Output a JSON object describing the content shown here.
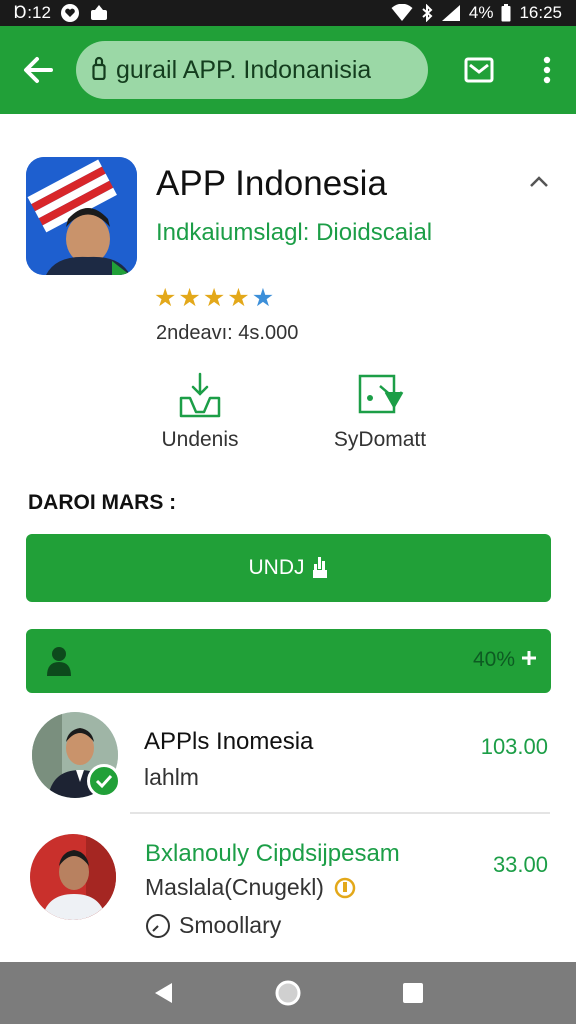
{
  "status_bar": {
    "time_left": "Ɒ:12",
    "battery": "4%",
    "time_right": "16:25"
  },
  "app_bar": {
    "url": "gurail APP. Indonanisia",
    "icons": [
      "back-arrow-icon",
      "lock-icon",
      "mail-icon",
      "more-vert-icon"
    ]
  },
  "app": {
    "title": "APP Indonesia",
    "developer": "Indkaiumslagl: Dioidscaial",
    "rating_stars": 5,
    "downloads": "2ndeavı: 4s.000"
  },
  "actions": [
    {
      "label": "Undenis",
      "icon": "download-hand-icon"
    },
    {
      "label": "SyDomatt",
      "icon": "share-image-icon"
    }
  ],
  "section_title": "DAROI MARS :",
  "install_button": {
    "label": "UNDJ"
  },
  "progress": {
    "label": "40%",
    "value": 0.4
  },
  "list": [
    {
      "title": "APPls Inomesia",
      "subtitle": "lahlm",
      "price": "103.00",
      "verified": true
    },
    {
      "title": "Bxlanouly Cipdsijpesam",
      "subtitle": "Maslala(Cnugekl)",
      "extra": "Smoollary",
      "price": "33.00"
    }
  ],
  "colors": {
    "primary": "#21a038",
    "url_pill": "#9bd8a6",
    "star": "#e3a81a",
    "nav": "#7c7c7c"
  }
}
